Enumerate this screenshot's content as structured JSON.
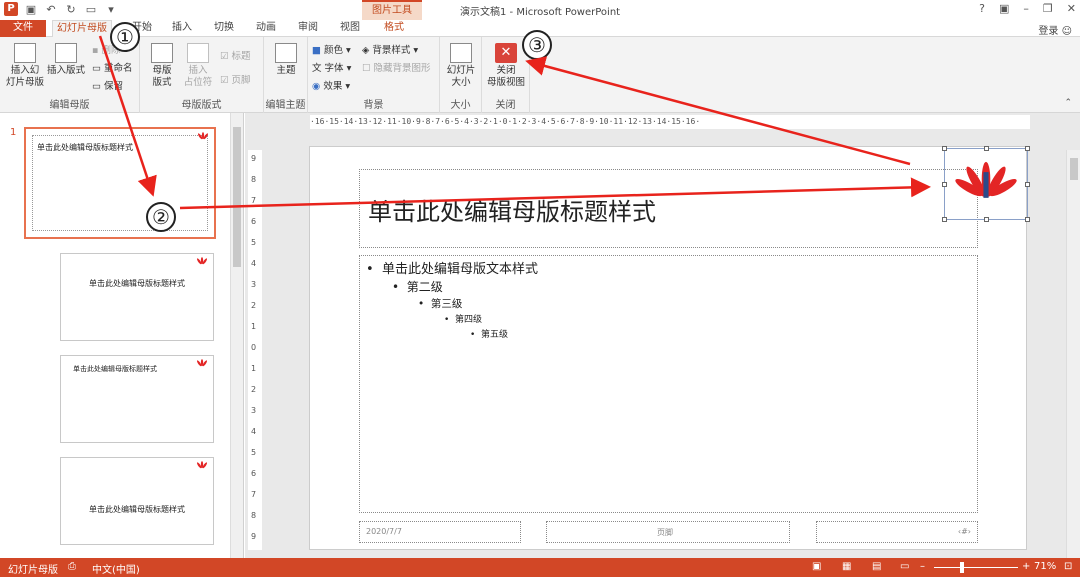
{
  "window": {
    "title": "演示文稿1 - Microsoft PowerPoint",
    "context_tools": "图片工具",
    "help": "?",
    "login": "登录"
  },
  "qat": {
    "app_icon": "P"
  },
  "tabs": [
    {
      "label": "文件"
    },
    {
      "label": "幻灯片母版"
    },
    {
      "label": "开始"
    },
    {
      "label": "插入"
    },
    {
      "label": "切换"
    },
    {
      "label": "动画"
    },
    {
      "label": "审阅"
    },
    {
      "label": "视图"
    },
    {
      "label": "格式"
    }
  ],
  "ribbon": {
    "edit_master": {
      "label": "编辑母版",
      "insert_slide_master": "插入幻\n灯片母版",
      "insert_layout": "插入版式",
      "delete": "删除",
      "rename": "重命名",
      "preserve": "保留"
    },
    "master_layout": {
      "label": "母版版式",
      "master_layout_btn": "母版\n版式",
      "insert_placeholder": "插入\n占位符",
      "title_chk": "标题",
      "footer_chk": "页脚"
    },
    "edit_theme": {
      "label": "编辑主题",
      "themes": "主题"
    },
    "background": {
      "label": "背景",
      "colors": "颜色",
      "fonts": "字体",
      "effects": "效果",
      "bg_styles": "背景样式",
      "hide_bg": "隐藏背景图形"
    },
    "size": {
      "label": "大小",
      "slide_size": "幻灯片\n大小"
    },
    "close": {
      "label": "关闭",
      "close_master": "关闭\n母版视图"
    }
  },
  "thumbnails": [
    {
      "index": "1",
      "title": "单击此处编辑母版标题样式"
    },
    {
      "title": "单击此处编辑母版标题样式"
    },
    {
      "title": "单击此处编辑母版标题样式"
    },
    {
      "title": "单击此处编辑母版标题样式"
    }
  ],
  "ruler": {
    "h": "·16·15·14·13·12·11·10·9·8·7·6·5·4·3·2·1·0·1·2·3·4·5·6·7·8·9·10·11·12·13·14·15·16·",
    "v": [
      "9",
      "8",
      "7",
      "6",
      "5",
      "4",
      "3",
      "2",
      "1",
      "0",
      "1",
      "2",
      "3",
      "4",
      "5",
      "6",
      "7",
      "8",
      "9"
    ]
  },
  "slide": {
    "title": "单击此处编辑母版标题样式",
    "levels": [
      "单击此处编辑母版文本样式",
      "第二级",
      "第三级",
      "第四级",
      "第五级"
    ],
    "footer_date": "2020/7/7",
    "footer_text": "页脚",
    "footer_num": "‹#›"
  },
  "annotations": [
    "①",
    "②",
    "③"
  ],
  "status": {
    "mode": "幻灯片母版",
    "language": "中文(中国)",
    "zoom": "71%",
    "zoom_level": 0.71
  },
  "colors": {
    "accent": "#d24726",
    "arrow": "#e8231c"
  }
}
